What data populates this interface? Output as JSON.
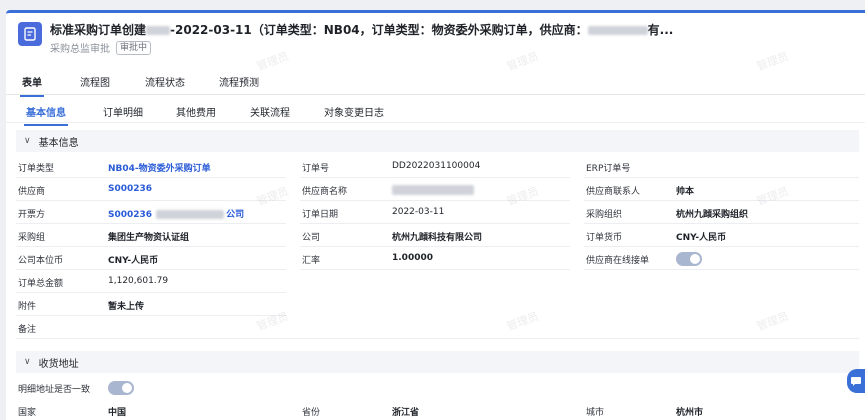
{
  "header": {
    "title_prefix": "标准采购订单创建",
    "title_mid": "-2022-03-11（订单类型：NB04，订单类型：物资委外采购订单，供应商：",
    "title_suffix": "有...",
    "subtitle": "采购总监审批",
    "status_badge": "审批中"
  },
  "main_tabs": [
    {
      "label": "表单",
      "active": true
    },
    {
      "label": "流程图"
    },
    {
      "label": "流程状态"
    },
    {
      "label": "流程预测"
    }
  ],
  "sub_tabs": [
    {
      "label": "基本信息",
      "active": true
    },
    {
      "label": "订单明细"
    },
    {
      "label": "其他费用"
    },
    {
      "label": "关联流程"
    },
    {
      "label": "对象变更日志"
    }
  ],
  "section_basic": {
    "title": "基本信息"
  },
  "basic": {
    "order_type": {
      "label": "订单类型",
      "value": "NB04-物资委外采购订单"
    },
    "order_no": {
      "label": "订单号",
      "value": "DD2022031100004"
    },
    "erp_no": {
      "label": "ERP订单号",
      "value": ""
    },
    "supplier": {
      "label": "供应商",
      "value": "S000236"
    },
    "supplier_name": {
      "label": "供应商名称",
      "value": ""
    },
    "supplier_contact": {
      "label": "供应商联系人",
      "value": "帅本"
    },
    "invoicer": {
      "label": "开票方",
      "value_prefix": "S000236",
      "value_suffix": "公司"
    },
    "order_date": {
      "label": "订单日期",
      "value": "2022-03-11"
    },
    "purchase_org": {
      "label": "采购组织",
      "value": "杭州九蹞采购组织"
    },
    "purchase_group": {
      "label": "采购组",
      "value": "集团生产物资认证组"
    },
    "company": {
      "label": "公司",
      "value": "杭州九蹞科技有限公司"
    },
    "order_currency": {
      "label": "订单货币",
      "value": "CNY-人民币"
    },
    "local_currency": {
      "label": "公司本位币",
      "value": "CNY-人民币"
    },
    "exchange_rate": {
      "label": "汇率",
      "value": "1.00000"
    },
    "online_accept": {
      "label": "供应商在线接单",
      "on": true
    },
    "total_amount": {
      "label": "订单总金额",
      "value": "1,120,601.79"
    },
    "attachment": {
      "label": "附件",
      "value": "暂未上传"
    },
    "remark": {
      "label": "备注",
      "value": ""
    }
  },
  "section_address": {
    "title": "收货地址"
  },
  "address": {
    "detail_same": {
      "label": "明细地址是否一致",
      "on": true
    },
    "country": {
      "label": "国家",
      "value": "中国"
    },
    "province": {
      "label": "省份",
      "value": "浙江省"
    },
    "city": {
      "label": "城市",
      "value": "杭州市"
    }
  },
  "watermark": "管理员",
  "colors": {
    "accent": "#3a6fd8",
    "link": "#2a5bd7"
  }
}
